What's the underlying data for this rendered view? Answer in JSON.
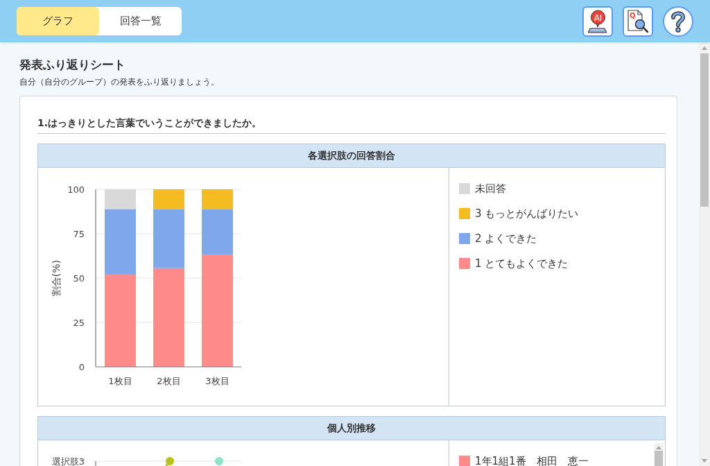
{
  "tabs": [
    {
      "label": "グラフ",
      "selected": true
    },
    {
      "label": "回答一覧",
      "selected": false
    }
  ],
  "toolbar": [
    {
      "kind": "ai",
      "text": "AI"
    },
    {
      "kind": "quiz",
      "text": "Q"
    },
    {
      "kind": "help"
    }
  ],
  "sheet": {
    "title": "発表ふり返りシート",
    "subtitle": "自分（自分のグループ）の発表をふり返りましょう。"
  },
  "question": {
    "title": "1.はっきりとした言葉でいうことができましたか。",
    "panels": [
      {
        "kind": "ratio",
        "title": "各選択肢の回答割合",
        "chart_data": {
          "type": "bar",
          "stacked": true,
          "grid": true,
          "ylabel": "割合(%)",
          "categories": [
            "1枚目",
            "2枚目",
            "3枚目"
          ],
          "ylim": [
            0,
            100
          ],
          "yticks": [
            0,
            25,
            50,
            75,
            100
          ],
          "series": [
            {
              "name": "未回答",
              "color": "#d9d9d9",
              "values": [
                11.1,
                0,
                0
              ]
            },
            {
              "name": "3 もっとがんばりたい",
              "color": "#f5bc22",
              "values": [
                0,
                11.1,
                11.1
              ]
            },
            {
              "name": "2 よくできた",
              "color": "#7fa8ec",
              "values": [
                37,
                33.3,
                25.9
              ]
            },
            {
              "name": "1 とてもよくできた",
              "color": "#ff8a8a",
              "values": [
                51.9,
                55.6,
                63
              ]
            }
          ]
        }
      },
      {
        "kind": "trend",
        "title": "個人別推移",
        "ytick_label": "選択肢3",
        "legend": [
          {
            "label": "1年1組1番　相田　恵一",
            "color": "#ff8a8a"
          }
        ]
      }
    ]
  }
}
